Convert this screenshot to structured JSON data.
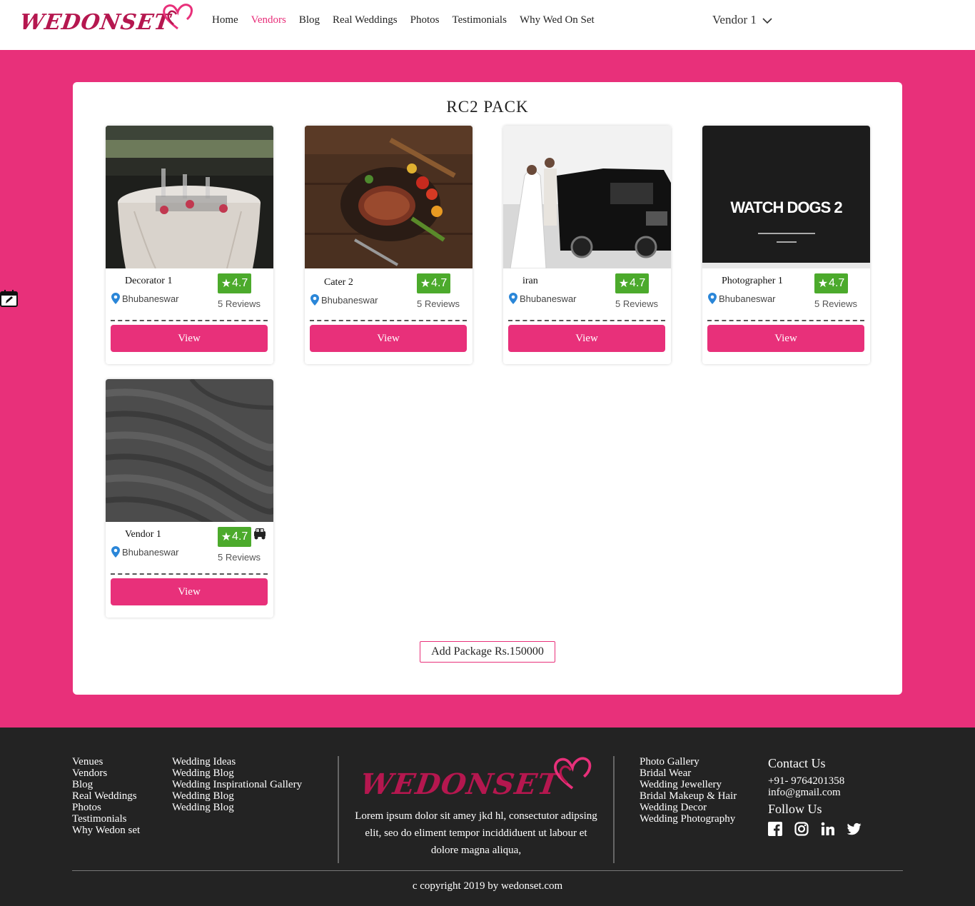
{
  "brand": {
    "logo_text": "WEDONSET",
    "accent": "#e8307a",
    "logo_color": "#b5174f"
  },
  "nav": {
    "items": [
      {
        "label": "Home",
        "active": false
      },
      {
        "label": "Vendors",
        "active": true
      },
      {
        "label": "Blog",
        "active": false
      },
      {
        "label": "Real Weddings",
        "active": false
      },
      {
        "label": "Photos",
        "active": false
      },
      {
        "label": "Testimonials",
        "active": false
      },
      {
        "label": "Why Wed On Set",
        "active": false
      }
    ],
    "user_label": "Vendor 1"
  },
  "package": {
    "title": "RC2  PACK",
    "add_button_label": "Add Package Rs.150000",
    "vendors": [
      {
        "name": "Decorator 1",
        "location": "Bhubaneswar",
        "rating": "4.7",
        "reviews": "5 Reviews",
        "view_label": "View",
        "image": "wedding-table-photo"
      },
      {
        "name": "Cater 2",
        "location": "Bhubaneswar",
        "rating": "4.7",
        "reviews": "5 Reviews",
        "view_label": "View",
        "image": "grilled-food-photo"
      },
      {
        "name": "iran",
        "location": "Bhubaneswar",
        "rating": "4.7",
        "reviews": "5 Reviews",
        "view_label": "View",
        "image": "wedding-couple-car-photo"
      },
      {
        "name": "Photographer 1",
        "location": "Bhubaneswar",
        "rating": "4.7",
        "reviews": "5 Reviews",
        "view_label": "View",
        "image": "watch-dogs-2-poster",
        "poster_title": "WATCH DOGS 2"
      },
      {
        "name": "Vendor 1",
        "location": "Bhubaneswar",
        "rating": "4.7",
        "reviews": "5 Reviews",
        "view_label": "View",
        "image": "grey-sand-texture",
        "extra_icon": "car-icon"
      }
    ]
  },
  "footer": {
    "col1": [
      "Venues",
      "Vendors",
      "Blog",
      "Real Weddings",
      "Photos",
      "Testimonials",
      "Why Wedon set"
    ],
    "col2": [
      "Wedding Ideas",
      "Wedding Blog",
      "Wedding Inspirational Gallery",
      "Wedding Blog",
      "Wedding Blog"
    ],
    "description": "Lorem ipsum dolor sit amey jkd hl, consectutor adipsing elit, seo do eliment tempor inciddiduent ut labour et dolore magna aliqua,",
    "col3": [
      "Photo Gallery",
      "Bridal Wear",
      "Wedding Jewellery",
      "Bridal Makeup & Hair",
      "Wedding Decor",
      "Wedding Photography"
    ],
    "contact_title": "Contact Us",
    "phone": "+91- 9764201358",
    "email": "info@gmail.com",
    "follow_title": "Follow Us",
    "socials": [
      "facebook-icon",
      "instagram-icon",
      "linkedin-icon",
      "twitter-icon"
    ],
    "copyright": "c copyright 2019 by wedonset.com"
  }
}
